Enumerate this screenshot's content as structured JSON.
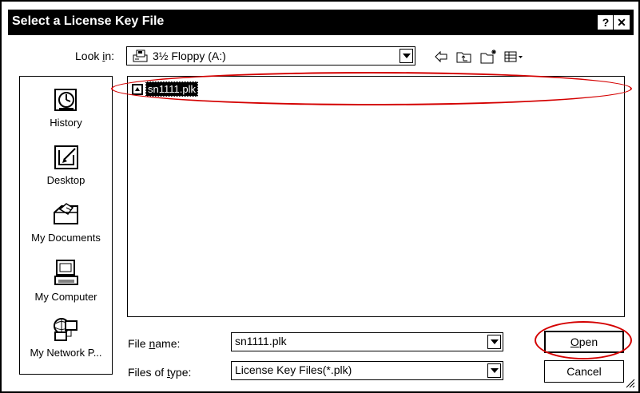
{
  "dialog": {
    "title": "Select a License Key File",
    "help_button": "?",
    "close_button": "✕"
  },
  "lookin": {
    "label_prefix": "Look ",
    "label_accel": "i",
    "label_suffix": "n:",
    "value": "3½ Floppy (A:)"
  },
  "places": [
    {
      "label": "History",
      "icon": "history-icon"
    },
    {
      "label": "Desktop",
      "icon": "desktop-icon"
    },
    {
      "label": "My Documents",
      "icon": "my-documents-icon"
    },
    {
      "label": "My Computer",
      "icon": "my-computer-icon"
    },
    {
      "label": "My Network P...",
      "icon": "my-network-places-icon"
    }
  ],
  "files": [
    {
      "name": "sn1111.plk",
      "selected": true,
      "icon": "file-icon"
    }
  ],
  "filename": {
    "label_prefix": "File ",
    "label_accel": "n",
    "label_suffix": "ame:",
    "value": "sn1111.plk"
  },
  "filetype": {
    "label_prefix": "Files of ",
    "label_accel": "t",
    "label_suffix": "ype:",
    "value": "License Key Files(*.plk)"
  },
  "buttons": {
    "open_accel": "O",
    "open_rest": "pen",
    "cancel": "Cancel"
  },
  "colors": {
    "highlight_annotation": "#d40000"
  }
}
